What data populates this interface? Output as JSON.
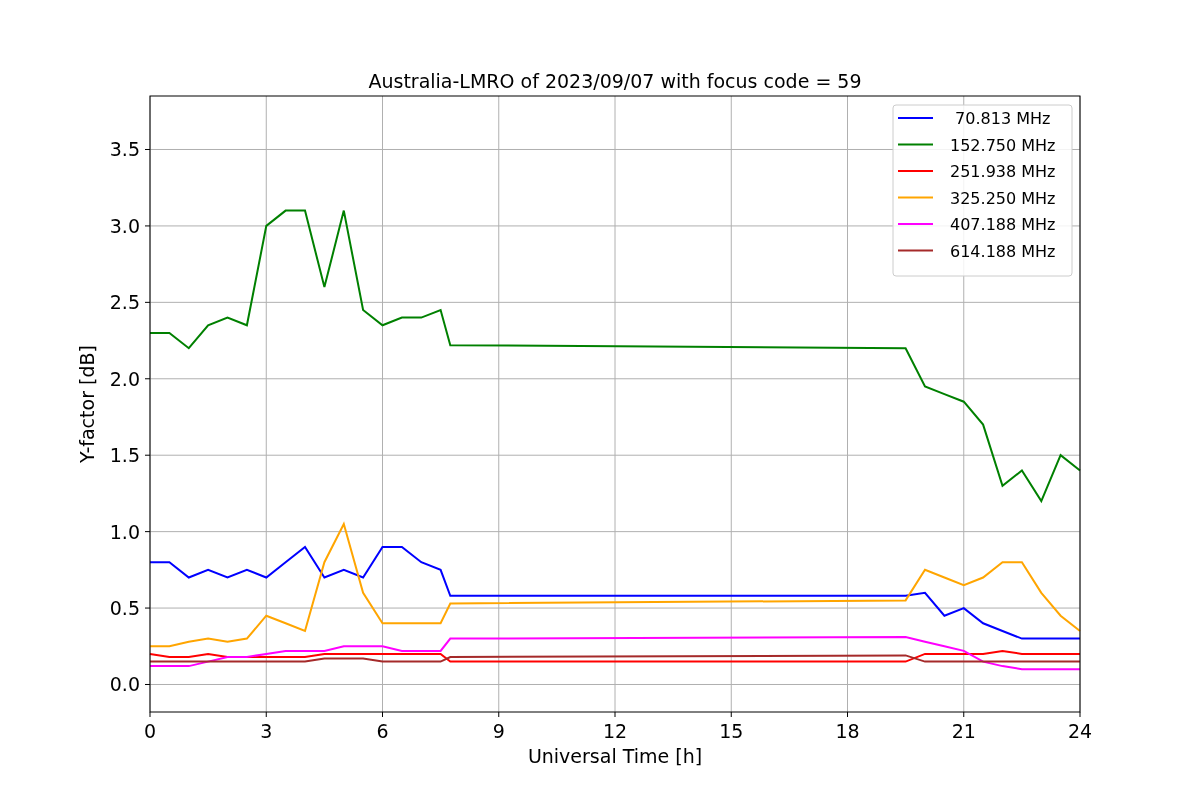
{
  "figure": {
    "chart_data": {
      "type": "line",
      "title": "Australia-LMRO of 2023/09/07 with focus code = 59",
      "xlabel": "Universal Time [h]",
      "ylabel": "Y-factor [dB]",
      "x": [
        0,
        0.5,
        1,
        1.5,
        2,
        2.5,
        3,
        3.5,
        4,
        4.5,
        5,
        5.5,
        6,
        6.5,
        7,
        7.5,
        7.75,
        19.5,
        20,
        20.5,
        21,
        21.5,
        22,
        22.5,
        23,
        23.5,
        24
      ],
      "series": [
        {
          "name": " 70.813 MHz",
          "color": "#0000ff",
          "values": [
            0.8,
            0.8,
            0.7,
            0.75,
            0.7,
            0.75,
            0.7,
            0.8,
            0.9,
            0.7,
            0.75,
            0.7,
            0.9,
            0.9,
            0.8,
            0.75,
            0.58,
            0.58,
            0.6,
            0.45,
            0.5,
            0.4,
            0.35,
            0.3,
            0.3,
            0.3,
            0.3
          ]
        },
        {
          "name": "152.750 MHz",
          "color": "#008000",
          "values": [
            2.3,
            2.3,
            2.2,
            2.35,
            2.4,
            2.35,
            3.0,
            3.1,
            3.1,
            2.6,
            3.1,
            2.45,
            2.35,
            2.4,
            2.4,
            2.45,
            2.22,
            2.2,
            1.95,
            1.9,
            1.85,
            1.7,
            1.3,
            1.4,
            1.2,
            1.5,
            1.4
          ]
        },
        {
          "name": "251.938 MHz",
          "color": "#ff0000",
          "values": [
            0.2,
            0.18,
            0.18,
            0.2,
            0.18,
            0.18,
            0.18,
            0.18,
            0.18,
            0.2,
            0.2,
            0.2,
            0.2,
            0.2,
            0.2,
            0.2,
            0.15,
            0.15,
            0.2,
            0.2,
            0.2,
            0.2,
            0.22,
            0.2,
            0.2,
            0.2,
            0.2
          ]
        },
        {
          "name": "325.250 MHz",
          "color": "#ffa500",
          "values": [
            0.25,
            0.25,
            0.28,
            0.3,
            0.28,
            0.3,
            0.45,
            0.4,
            0.35,
            0.8,
            1.05,
            0.6,
            0.4,
            0.4,
            0.4,
            0.4,
            0.53,
            0.55,
            0.75,
            0.7,
            0.65,
            0.7,
            0.8,
            0.8,
            0.6,
            0.45,
            0.35
          ]
        },
        {
          "name": "407.188 MHz",
          "color": "#ff00ff",
          "values": [
            0.12,
            0.12,
            0.12,
            0.15,
            0.18,
            0.18,
            0.2,
            0.22,
            0.22,
            0.22,
            0.25,
            0.25,
            0.25,
            0.22,
            0.22,
            0.22,
            0.3,
            0.31,
            0.28,
            0.25,
            0.22,
            0.15,
            0.12,
            0.1,
            0.1,
            0.1,
            0.1
          ]
        },
        {
          "name": "614.188 MHz",
          "color": "#a52a2a",
          "values": [
            0.15,
            0.15,
            0.15,
            0.15,
            0.15,
            0.15,
            0.15,
            0.15,
            0.15,
            0.17,
            0.17,
            0.17,
            0.15,
            0.15,
            0.15,
            0.15,
            0.18,
            0.19,
            0.15,
            0.15,
            0.15,
            0.15,
            0.15,
            0.15,
            0.15,
            0.15,
            0.15
          ]
        }
      ],
      "grid": true,
      "legend": "upper right",
      "xlim": [
        0,
        24
      ],
      "ylim": [
        -0.18,
        3.85
      ],
      "xticks": [
        0,
        3,
        6,
        9,
        12,
        15,
        18,
        21,
        24
      ],
      "yticks": [
        {
          "value": 0,
          "label": "0.0"
        },
        {
          "value": 0.5,
          "label": "0.5"
        },
        {
          "value": 1,
          "label": "1.0"
        },
        {
          "value": 1.5,
          "label": "1.5"
        },
        {
          "value": 2,
          "label": "2.0"
        },
        {
          "value": 2.5,
          "label": "2.5"
        },
        {
          "value": 3,
          "label": "3.0"
        },
        {
          "value": 3.5,
          "label": "3.5"
        }
      ]
    }
  }
}
